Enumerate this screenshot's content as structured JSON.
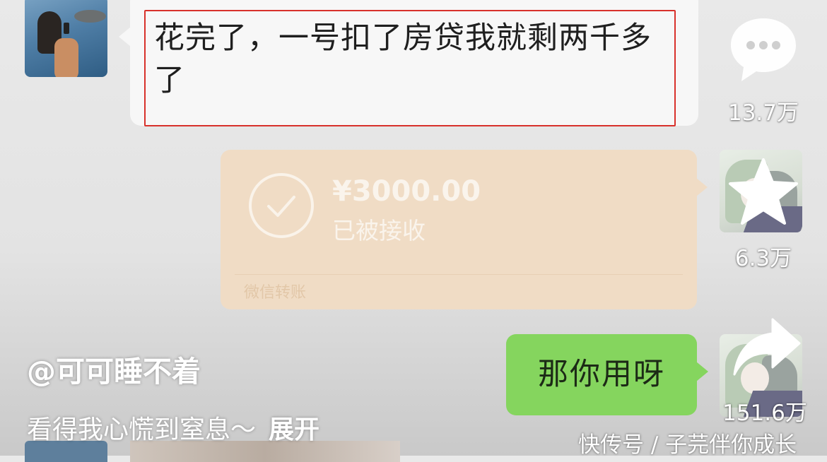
{
  "chat": {
    "received_message": "花完了，一号扣了房贷我就剩两千多了",
    "transfer": {
      "amount": "¥3000.00",
      "status": "已被接收",
      "footer": "微信转账"
    },
    "sent_message": "那你用呀"
  },
  "actions": {
    "comment_count": "13.7万",
    "favorite_count": "6.3万",
    "share_count": "151.6万"
  },
  "post": {
    "author": "@可可睡不着",
    "description": "看得我心慌到窒息～",
    "expand_label": "展开"
  },
  "watermark": "快传号 / 子芫伴你成长",
  "colors": {
    "highlight_border": "#d8312b",
    "transfer_bubble": "#f0dcc5",
    "sent_bubble": "#85d55e"
  }
}
